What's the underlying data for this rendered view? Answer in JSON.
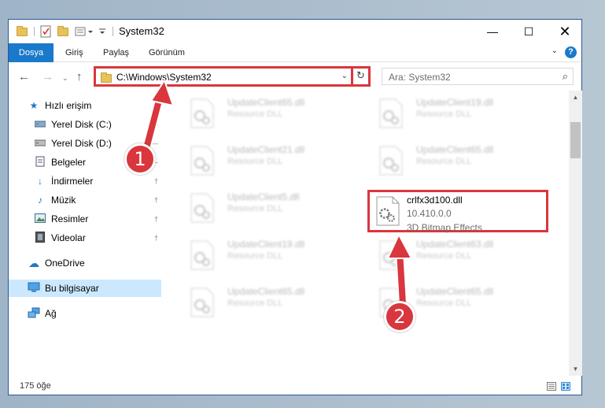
{
  "window": {
    "title": "System32"
  },
  "ribbon": {
    "tabs": [
      "Dosya",
      "Giriş",
      "Paylaş",
      "Görünüm"
    ]
  },
  "address": {
    "path": "C:\\Windows\\System32"
  },
  "search": {
    "placeholder": "Ara: System32"
  },
  "nav": {
    "items": [
      {
        "label": "Hızlı erişim",
        "icon": "star-icon"
      },
      {
        "label": "Yerel Disk (C:)",
        "icon": "drive-icon"
      },
      {
        "label": "Yerel Disk (D:)",
        "icon": "drive-icon"
      },
      {
        "label": "Belgeler",
        "icon": "document-icon"
      },
      {
        "label": "İndirmeler",
        "icon": "download-icon"
      },
      {
        "label": "Müzik",
        "icon": "music-icon"
      },
      {
        "label": "Resimler",
        "icon": "pictures-icon"
      },
      {
        "label": "Videolar",
        "icon": "video-icon"
      },
      {
        "label": "OneDrive",
        "icon": "cloud-icon"
      },
      {
        "label": "Bu bilgisayar",
        "icon": "computer-icon"
      },
      {
        "label": "Ağ",
        "icon": "network-icon"
      }
    ]
  },
  "files": [
    {
      "name": "UpdateClient65.dll",
      "desc": "Resource DLL"
    },
    {
      "name": "UpdateClient19.dll",
      "desc": "Resource DLL"
    },
    {
      "name": "UpdateClient21.dll",
      "desc": "Resource DLL"
    },
    {
      "name": "UpdateClient65.dll",
      "desc": "Resource DLL"
    },
    {
      "name": "UpdateClient5.dll",
      "desc": "Resource DLL"
    },
    {
      "name": "crlfx3d100.dll",
      "version": "10.410.0.0",
      "desc": "3D Bitmap Effects"
    },
    {
      "name": "UpdateClient19.dll",
      "desc": "Resource DLL"
    },
    {
      "name": "UpdateClient63.dll",
      "desc": "Resource DLL"
    },
    {
      "name": "UpdateClient65.dll",
      "desc": "Resource DLL"
    },
    {
      "name": "UpdateClient65.dll",
      "desc": "Resource DLL"
    }
  ],
  "status": {
    "item_count": "175 öğe"
  },
  "annotations": {
    "step1": "1",
    "step2": "2",
    "color": "#d9363e"
  }
}
